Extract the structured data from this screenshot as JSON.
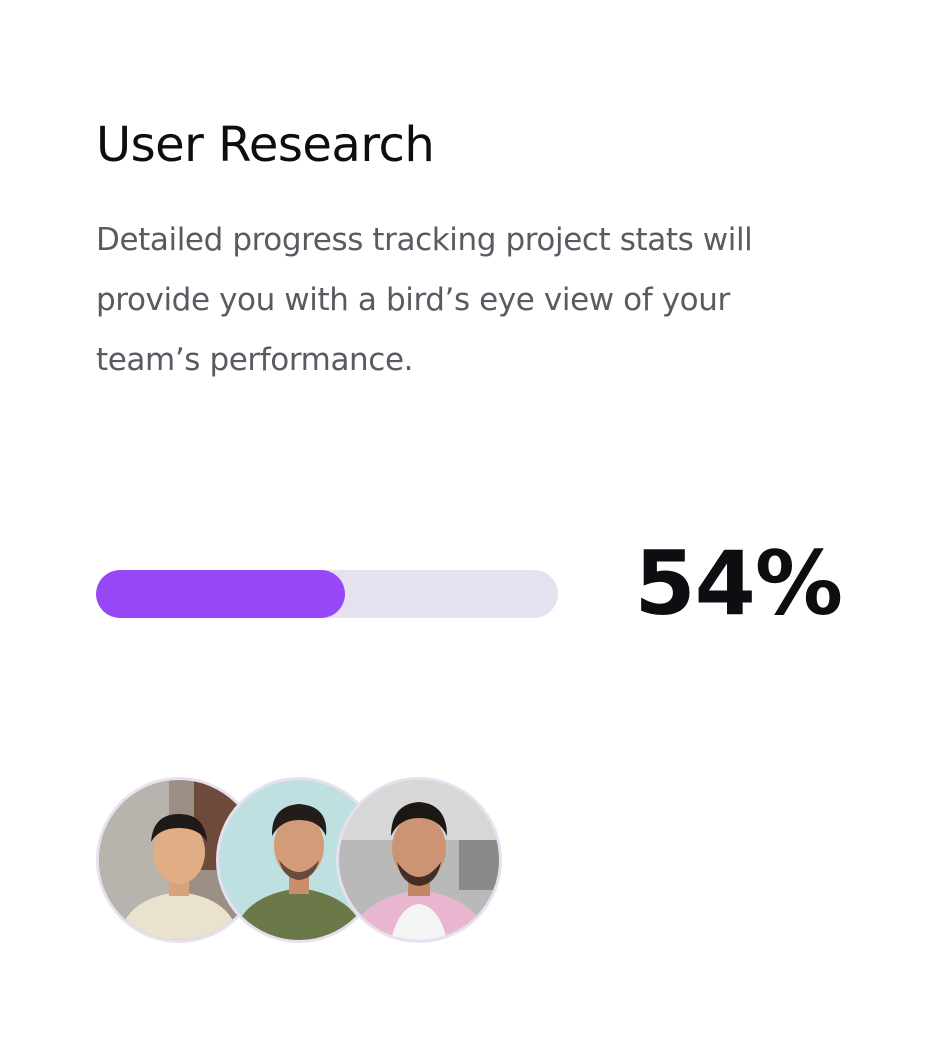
{
  "card": {
    "title": "User Research",
    "description": "Detailed progress tracking project stats will provide you with a bird’s eye view of your team’s performance."
  },
  "progress": {
    "value": 0.54,
    "label": "54%",
    "fill_color": "#9747f5",
    "track_color": "#e6e1ee"
  },
  "team": {
    "avatars": [
      {
        "icon": "person-photo-avatar"
      },
      {
        "icon": "person-photo-avatar"
      },
      {
        "icon": "person-photo-avatar"
      }
    ]
  }
}
